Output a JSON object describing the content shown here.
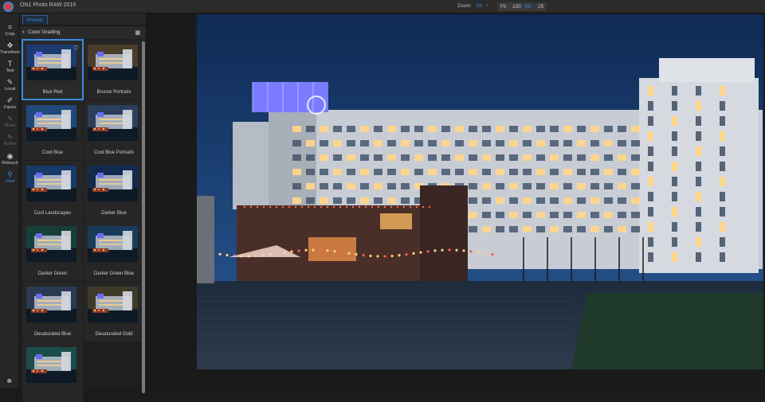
{
  "app": {
    "title": "ON1 Photo RAW 2019"
  },
  "zoom": {
    "label": "Zoom",
    "value": "50",
    "minus": "–",
    "options": [
      "Fit",
      "100",
      "50",
      "25"
    ],
    "active": "50"
  },
  "toolbar": {
    "tools": [
      {
        "label": "Crop",
        "icon": "crop-icon",
        "glyph": "⌗"
      },
      {
        "label": "Transform",
        "icon": "move-icon",
        "glyph": "✥"
      },
      {
        "label": "Text",
        "icon": "text-icon",
        "glyph": "T"
      },
      {
        "label": "Local",
        "icon": "brush-icon",
        "glyph": "✎"
      },
      {
        "label": "Faces",
        "icon": "faces-icon",
        "glyph": "✐"
      },
      {
        "label": "Mask",
        "icon": "mask-brush-icon",
        "glyph": "✎"
      },
      {
        "label": "Refine",
        "icon": "refine-brush-icon",
        "glyph": "✎"
      },
      {
        "label": "Retouch",
        "icon": "retouch-icon",
        "glyph": "◉"
      },
      {
        "label": "View",
        "icon": "view-icon",
        "glyph": "⚲"
      }
    ],
    "user_icon": "user-icon"
  },
  "panel": {
    "tab": "Presets",
    "category": "Color Grading",
    "presets": [
      "Blue Red",
      "Bronze Portraits",
      "Cool Blue",
      "Cool Blue Portraits",
      "Cool Landscapes",
      "Darker Blue",
      "Darker Green",
      "Darker Green Blue",
      "Desaturated Blue",
      "Desaturated Gold",
      ""
    ],
    "selected": "Blue Red"
  },
  "colors": {
    "accent": "#3b8be0",
    "sky": "#15305a",
    "building": "#c8ccd4",
    "window_warm": "#ffd58a",
    "neon": "#7a7cff"
  }
}
